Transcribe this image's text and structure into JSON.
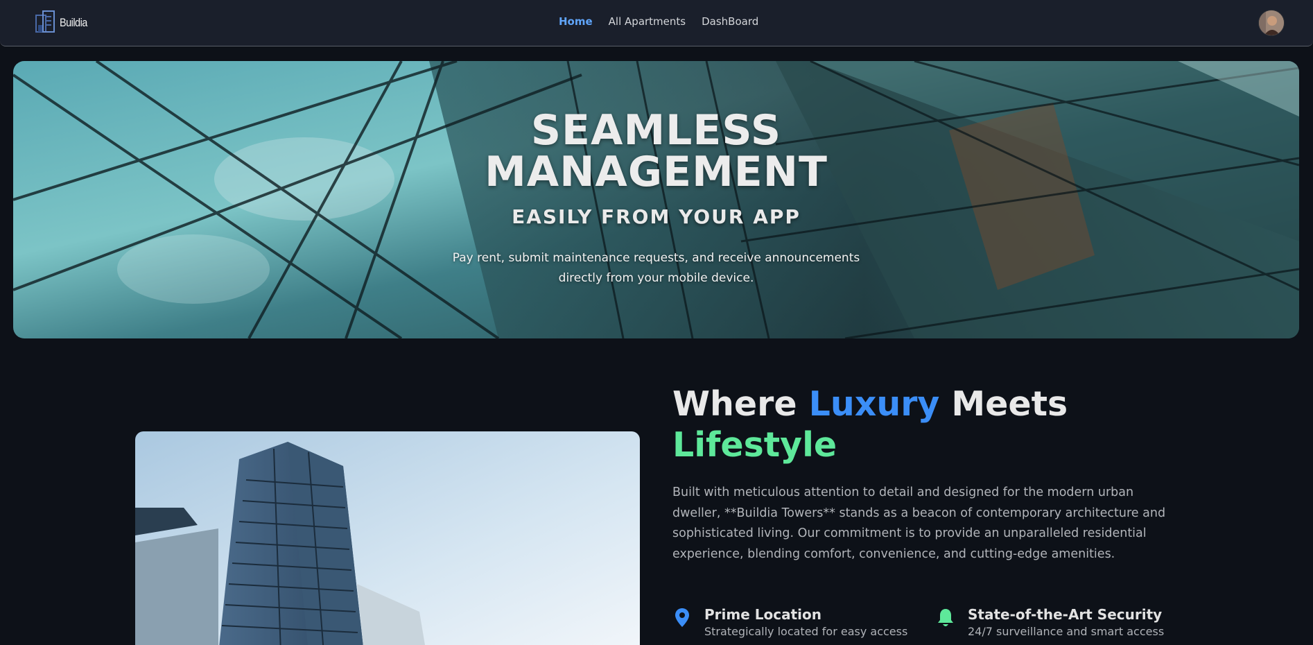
{
  "navbar": {
    "logo_text": "Buildia",
    "links": [
      {
        "label": "Home",
        "active": true
      },
      {
        "label": "All Apartments",
        "active": false
      },
      {
        "label": "DashBoard",
        "active": false
      }
    ]
  },
  "hero": {
    "title_line1": "SEAMLESS",
    "title_line2": "MANAGEMENT",
    "subtitle": "EASILY FROM YOUR APP",
    "description": "Pay rent, submit maintenance requests, and receive announcements directly from your mobile device."
  },
  "about": {
    "title_part1": "Where ",
    "title_highlight1": "Luxury",
    "title_part2": " Meets",
    "title_highlight2": "Lifestyle",
    "paragraph": "Built with meticulous attention to detail and designed for the modern urban dweller, **Buildia Towers** stands as a beacon of contemporary architecture and sophisticated living. Our commitment is to provide an unparalleled residential experience, blending comfort, convenience, and cutting-edge amenities.",
    "features": [
      {
        "icon": "map-pin-icon",
        "title": "Prime Location",
        "description": "Strategically located for easy access"
      },
      {
        "icon": "bell-icon",
        "title": "State-of-the-Art Security",
        "description": "24/7 surveillance and smart access"
      }
    ]
  },
  "colors": {
    "accent_blue": "#3b8ef7",
    "accent_green": "#5ee89a",
    "nav_active": "#60a5fa",
    "background": "#0d1118"
  }
}
